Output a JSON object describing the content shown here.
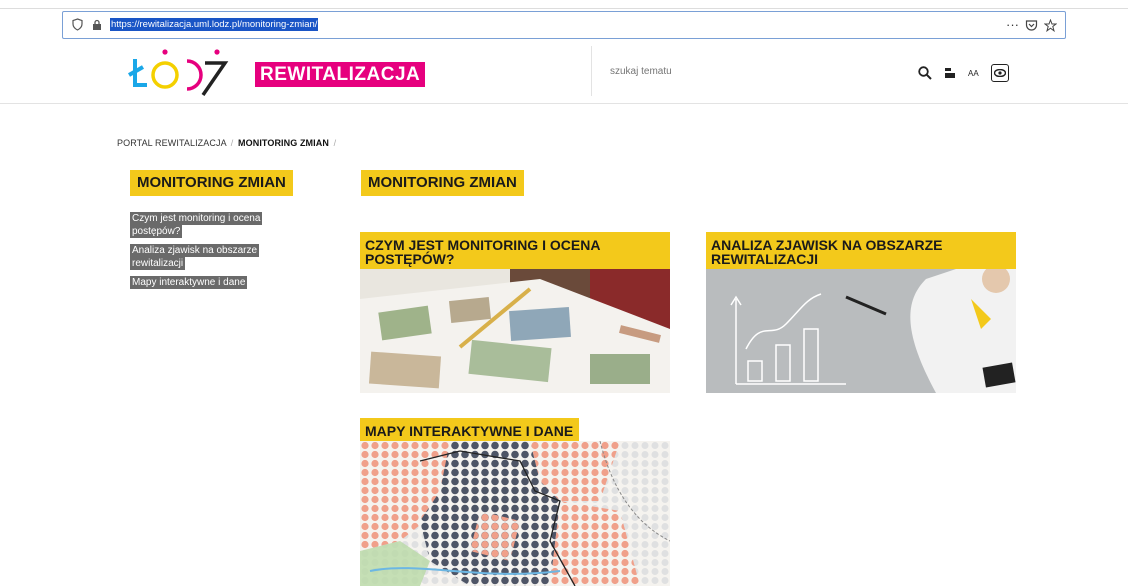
{
  "browser": {
    "url": "https://rewitalizacja.uml.lodz.pl/monitoring-zmian/",
    "menu_icon": "more-icon",
    "pocket_icon": "pocket-icon",
    "star_icon": "bookmark-star-icon"
  },
  "header": {
    "brand_label": "REWITALIZACJA",
    "search_placeholder": "szukaj tematu",
    "font_size_label": "AA"
  },
  "breadcrumb": {
    "home": "PORTAL REWITALIZACJA",
    "separator": "/",
    "current": "MONITORING ZMIAN"
  },
  "sidebar": {
    "title": "MONITORING ZMIAN",
    "items": [
      {
        "label": "Czym jest monitoring i ocena postępów?"
      },
      {
        "label": "Analiza zjawisk na obszarze rewitalizacji"
      },
      {
        "label": "Mapy interaktywne i dane"
      }
    ]
  },
  "main": {
    "title": "MONITORING ZMIAN",
    "cards": [
      {
        "title": "CZYM JEST MONITORING I OCENA POSTĘPÓW?"
      },
      {
        "title": "ANALIZA ZJAWISK NA OBSZARZE REWITALIZACJI"
      },
      {
        "title": "MAPY INTERAKTYWNE I DANE"
      }
    ]
  },
  "colors": {
    "accent_yellow": "#f3c91b",
    "brand_magenta": "#e6007e",
    "sidebar_link_bg": "#6a6a6a"
  }
}
